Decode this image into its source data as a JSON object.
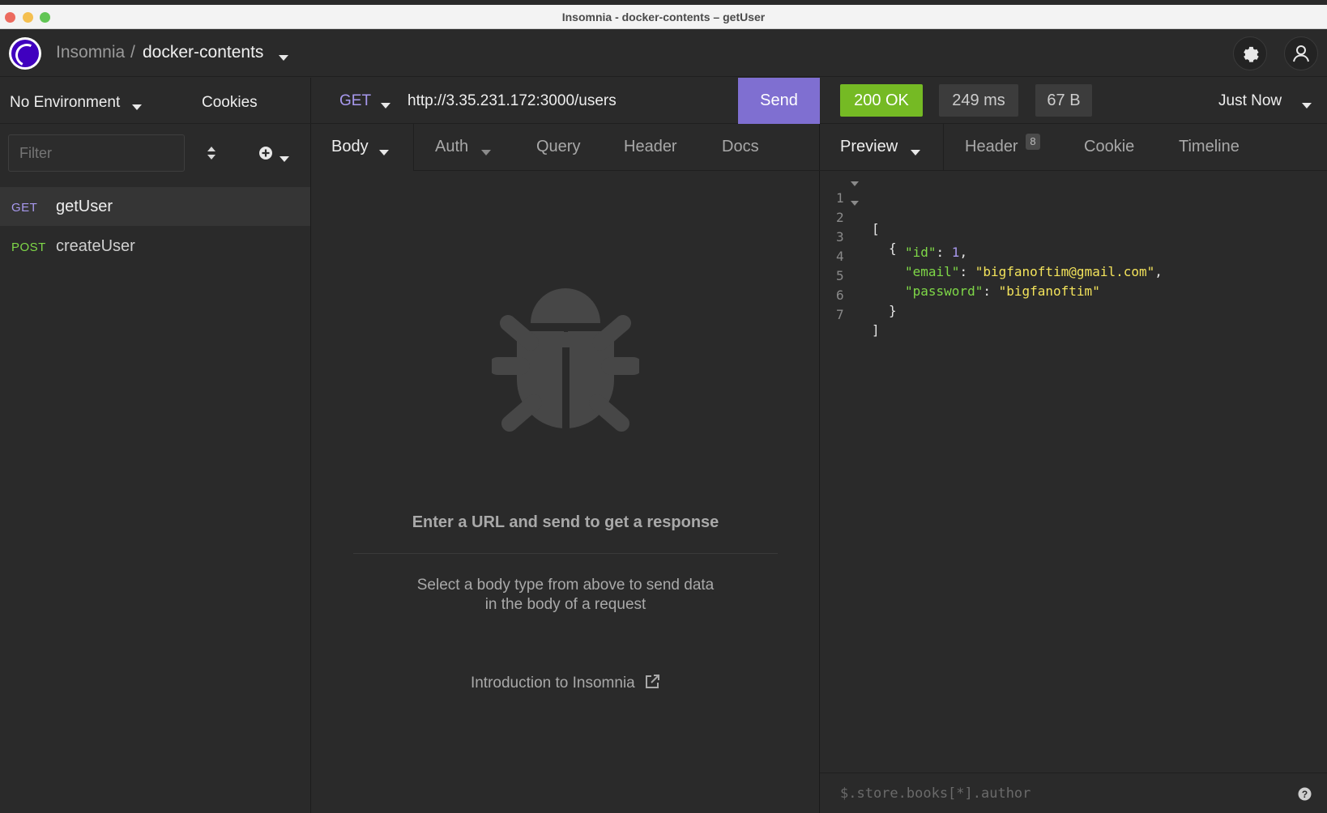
{
  "window": {
    "title": "Insomnia - docker-contents – getUser"
  },
  "header": {
    "app_name": "Insomnia",
    "separator": "/",
    "workspace": "docker-contents"
  },
  "sidebar": {
    "environment": "No Environment",
    "cookies_label": "Cookies",
    "filter_placeholder": "Filter",
    "requests": [
      {
        "method": "GET",
        "name": "getUser"
      },
      {
        "method": "POST",
        "name": "createUser"
      }
    ]
  },
  "request": {
    "method": "GET",
    "url": "http://3.35.231.172:3000/users",
    "send_label": "Send",
    "tabs": [
      "Body",
      "Auth",
      "Query",
      "Header",
      "Docs"
    ],
    "empty_title": "Enter a URL and send to get a response",
    "empty_hint_line1": "Select a body type from above to send data",
    "empty_hint_line2": "in the body of a request",
    "intro_link": "Introduction to Insomnia"
  },
  "response": {
    "status": "200 OK",
    "time": "249 ms",
    "size": "67 B",
    "timestamp": "Just Now",
    "tabs": [
      "Preview",
      "Header",
      "Cookie",
      "Timeline"
    ],
    "header_count": "8",
    "line_numbers": [
      "1",
      "2",
      "3",
      "4",
      "5",
      "6",
      "7"
    ],
    "body": {
      "open_bracket": "[",
      "open_brace": "{",
      "id_key": "\"id\"",
      "id_value": "1",
      "email_key": "\"email\"",
      "email_value": "\"bigfanoftim@gmail.com\"",
      "password_key": "\"password\"",
      "password_value": "\"bigfanoftim\"",
      "close_brace": "}",
      "close_bracket": "]"
    },
    "filter_placeholder": "$.store.books[*].author"
  },
  "colors": {
    "accent": "#7f6fd1",
    "get_method": "#a899ee",
    "post_method": "#7fd848",
    "status_ok": "#75ba24",
    "json_key": "#7fd848",
    "json_string": "#f3e35b"
  },
  "icons": [
    "insomnia-logo-icon",
    "gear-icon",
    "user-icon",
    "sort-icon",
    "add-circle-icon",
    "bug-icon",
    "external-link-icon",
    "help-icon"
  ]
}
